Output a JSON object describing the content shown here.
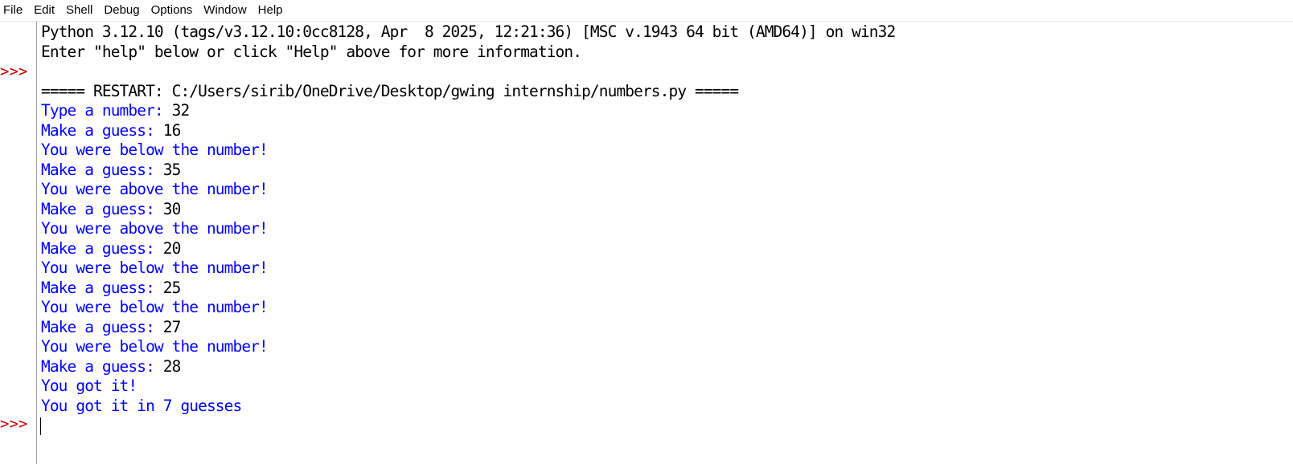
{
  "menubar": {
    "items": [
      "File",
      "Edit",
      "Shell",
      "Debug",
      "Options",
      "Window",
      "Help"
    ]
  },
  "gutter": {
    "prompt_symbol": ">>>"
  },
  "shell": {
    "banner_line1": "Python 3.12.10 (tags/v3.12.10:0cc8128, Apr  8 2025, 12:21:36) [MSC v.1943 64 bit (AMD64)] on win32",
    "banner_line2": "Enter \"help\" below or click \"Help\" above for more information.",
    "restart_line": "===== RESTART: C:/Users/sirib/OneDrive/Desktop/gwing internship/numbers.py =====",
    "output": [
      {
        "prompt": "Type a number: ",
        "input": "32"
      },
      {
        "prompt": "Make a guess: ",
        "input": "16"
      },
      {
        "prompt": "You were below the number!",
        "input": ""
      },
      {
        "prompt": "Make a guess: ",
        "input": "35"
      },
      {
        "prompt": "You were above the number!",
        "input": ""
      },
      {
        "prompt": "Make a guess: ",
        "input": "30"
      },
      {
        "prompt": "You were above the number!",
        "input": ""
      },
      {
        "prompt": "Make a guess: ",
        "input": "20"
      },
      {
        "prompt": "You were below the number!",
        "input": ""
      },
      {
        "prompt": "Make a guess: ",
        "input": "25"
      },
      {
        "prompt": "You were below the number!",
        "input": ""
      },
      {
        "prompt": "Make a guess: ",
        "input": "27"
      },
      {
        "prompt": "You were below the number!",
        "input": ""
      },
      {
        "prompt": "Make a guess: ",
        "input": "28"
      },
      {
        "prompt": "You got it!",
        "input": ""
      },
      {
        "prompt": "You got it in 7 guesses",
        "input": ""
      }
    ]
  },
  "colors": {
    "stdout": "#0000ff",
    "stdin": "#000000",
    "prompt": "#c00000"
  }
}
